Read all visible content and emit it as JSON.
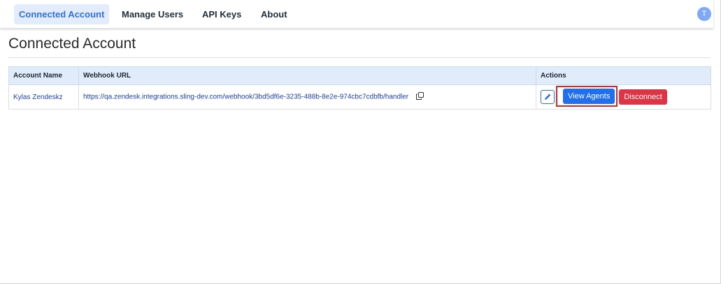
{
  "nav": {
    "tabs": [
      {
        "label": "Connected Account",
        "active": true
      },
      {
        "label": "Manage Users",
        "active": false
      },
      {
        "label": "API Keys",
        "active": false
      },
      {
        "label": "About",
        "active": false
      }
    ],
    "avatar_initial": "T"
  },
  "page": {
    "title": "Connected Account"
  },
  "table": {
    "headers": [
      "Account Name",
      "Webhook URL",
      "Actions"
    ],
    "rows": [
      {
        "account_name": "Kylas Zendeskz",
        "webhook_url": "https://qa.zendesk.integrations.sling-dev.com/webhook/3bd5df6e-3235-488b-8e2e-974cbc7cdbfb/handler",
        "actions": {
          "view_label": "View Agents",
          "disconnect_label": "Disconnect"
        }
      }
    ]
  },
  "colors": {
    "primary": "#1f6ff0",
    "danger": "#dc3545",
    "highlight_box": "#d8262b",
    "nav_active_bg": "#e3ecfa",
    "table_header_bg": "#e1ecfa",
    "avatar_bg": "#7fa8f5"
  },
  "icons": {
    "copy": "copy-icon",
    "edit": "pencil-icon"
  }
}
